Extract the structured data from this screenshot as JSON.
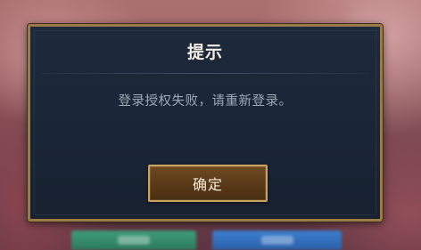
{
  "dialog": {
    "title": "提示",
    "message": "登录授权失败，请重新登录。",
    "confirm_label": "确定"
  },
  "colors": {
    "dialog_border": "#9a7a45",
    "dialog_background": "#1b2738",
    "button_border": "#c9a461",
    "button_fill": "#5a3a18",
    "title_text": "#f2ede2",
    "message_text": "#9fa9b6"
  }
}
